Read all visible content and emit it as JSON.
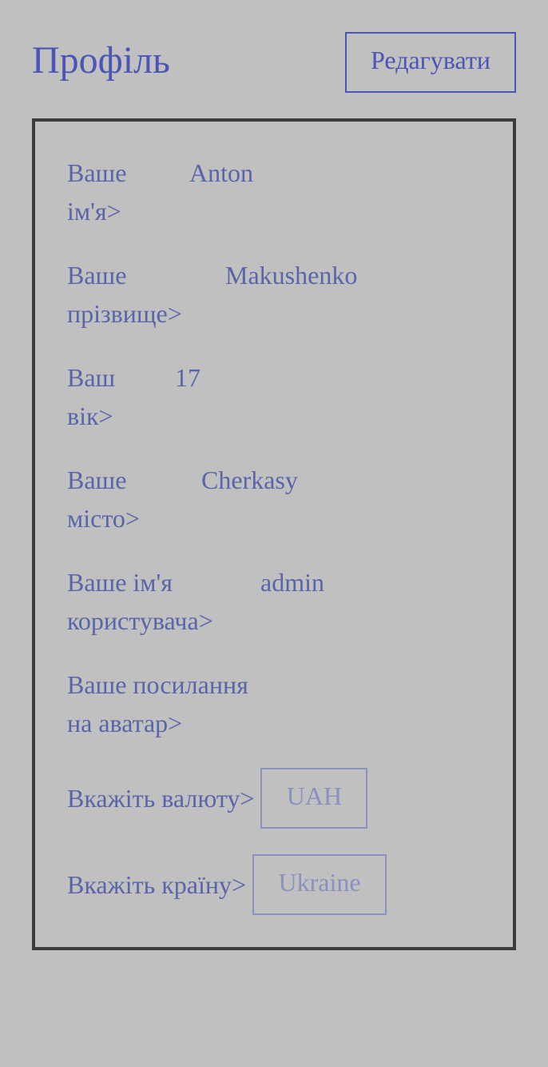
{
  "header": {
    "title": "Профіль",
    "edit_label": "Редагувати"
  },
  "profile": {
    "first_name": {
      "label_line1": "Ваше",
      "label_line2": "ім'я>",
      "value": "Anton"
    },
    "last_name": {
      "label_line1": "Ваше",
      "label_line2": "прізвище>",
      "value": "Makushenko"
    },
    "age": {
      "label_line1": "Ваш",
      "label_line2": "вік>",
      "value": "17"
    },
    "city": {
      "label_line1": "Ваше",
      "label_line2": "місто>",
      "value": "Cherkasy"
    },
    "username": {
      "label_line1": "Ваше ім'я",
      "label_line2": "користувача>",
      "value": "admin"
    },
    "avatar": {
      "label_line1": "Ваше посилання",
      "label_line2": "на аватар>",
      "value": ""
    },
    "currency": {
      "label": "Вкажіть валюту>",
      "value": "UAH"
    },
    "country": {
      "label": "Вкажіть країну>",
      "value": "Ukraine"
    }
  },
  "colors": {
    "background": "#c0c0c0",
    "accent": "#4a55b5",
    "text": "#5a64a8",
    "card_border": "#3c3c3c"
  }
}
